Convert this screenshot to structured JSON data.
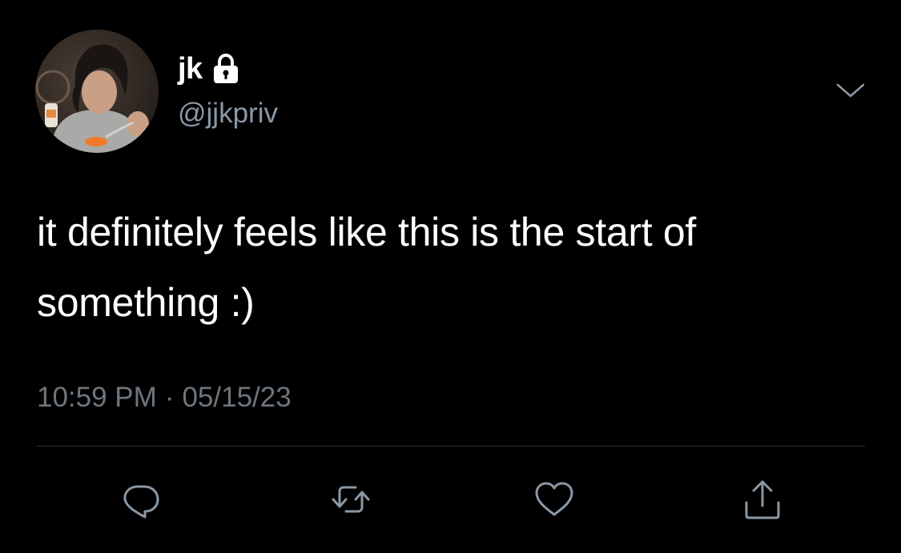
{
  "user": {
    "display_name": "jk",
    "handle": "@jjkpriv",
    "protected_icon": "lock-icon",
    "avatar": "profile-photo"
  },
  "tweet": {
    "text": "it definitely feels like this is the start of something :)",
    "time": "10:59 PM",
    "separator": "·",
    "date": "05/15/23"
  },
  "actions": [
    {
      "icon": "reply-icon"
    },
    {
      "icon": "retweet-icon"
    },
    {
      "icon": "like-icon"
    },
    {
      "icon": "share-icon"
    }
  ],
  "menu_icon": "chevron-down-icon",
  "colors": {
    "background": "#000000",
    "text_primary": "#ffffff",
    "text_secondary": "#8b98a5",
    "text_meta": "#6e767d",
    "icon": "#8b98a5",
    "divider": "#2f3336"
  }
}
